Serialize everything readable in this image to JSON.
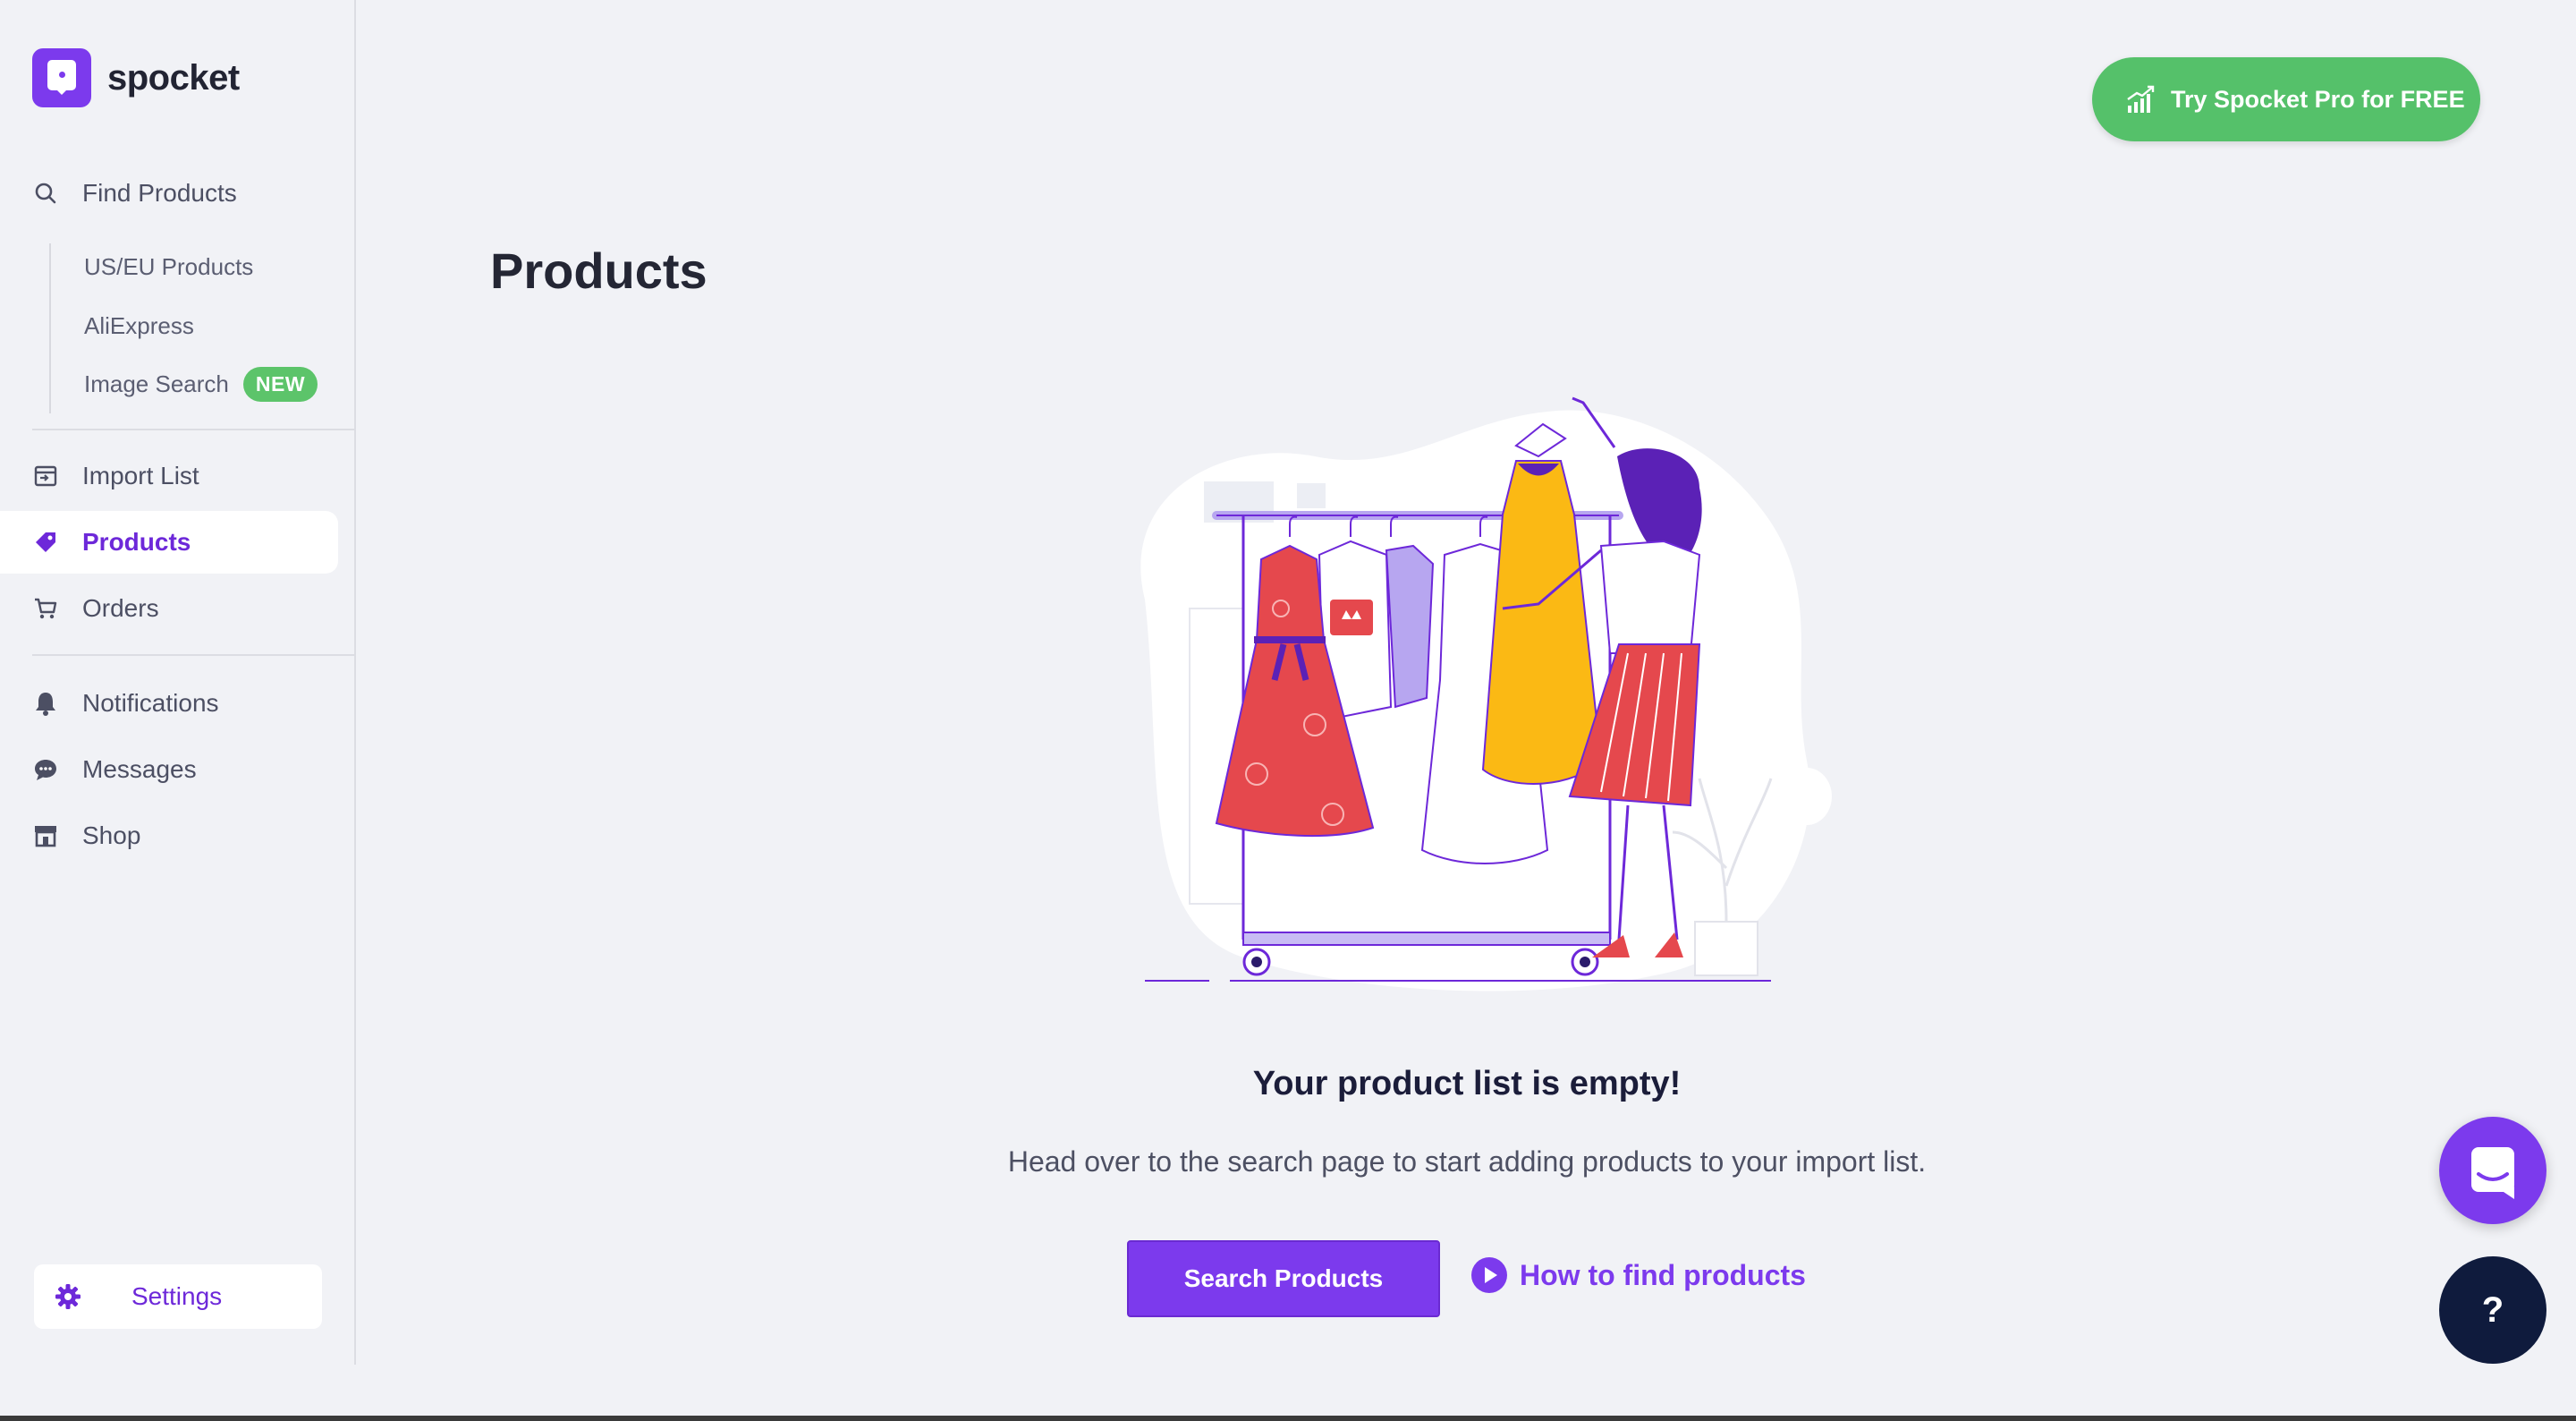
{
  "app": {
    "name": "spocket"
  },
  "sidebar": {
    "find_products": "Find Products",
    "sub_items": [
      {
        "label": "US/EU Products"
      },
      {
        "label": "AliExpress"
      },
      {
        "label": "Image Search",
        "badge": "NEW"
      }
    ],
    "items": [
      {
        "label": "Import List",
        "icon": "import-list-icon"
      },
      {
        "label": "Products",
        "icon": "tag-icon",
        "active": true
      },
      {
        "label": "Orders",
        "icon": "cart-icon"
      },
      {
        "label": "Notifications",
        "icon": "bell-icon"
      },
      {
        "label": "Messages",
        "icon": "chat-bubble-icon"
      },
      {
        "label": "Shop",
        "icon": "store-icon"
      }
    ],
    "settings": "Settings"
  },
  "header": {
    "pro_button": "Try Spocket Pro for FREE"
  },
  "main": {
    "title": "Products",
    "empty_title": "Your product list is empty!",
    "empty_subtitle": "Head over to the search page to start adding products to your import list.",
    "search_button": "Search Products",
    "how_link": "How to find products"
  },
  "floating": {
    "help_label": "?"
  },
  "colors": {
    "accent": "#7c3aed",
    "green": "#55c16a",
    "background": "#f1f2f6",
    "dark_navy": "#0f1b3d"
  }
}
